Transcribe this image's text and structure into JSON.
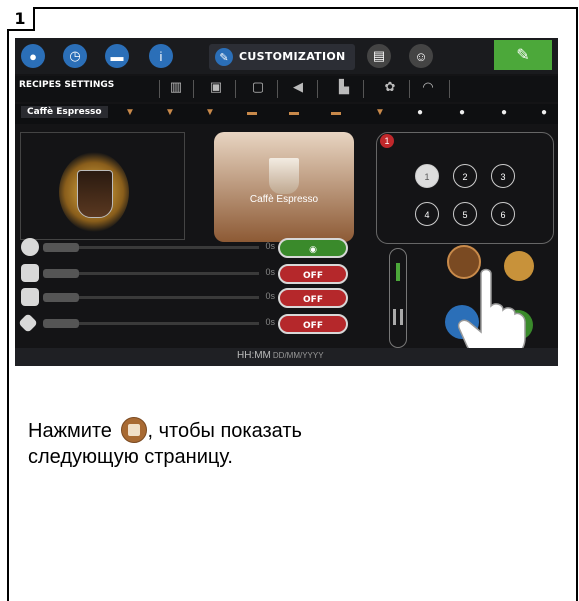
{
  "step": {
    "number": "1"
  },
  "screen": {
    "topbar": {
      "icons": [
        "drop-icon",
        "clock-icon",
        "cup-icon",
        "info-icon",
        "pencil-icon",
        "display-icon",
        "user-icon",
        "wrench-icon"
      ],
      "active_tab_label": "CUSTOMIZATION"
    },
    "submenu": {
      "recipes_settings_label": "RECIPES SETTINGS",
      "icons": [
        "book-icon",
        "picture-icon",
        "screen-icon",
        "speaker-icon",
        "milk-icon",
        "palette-icon",
        "wifi-icon"
      ]
    },
    "beverage_bar": {
      "selected_label": "Caffè Espresso"
    },
    "preview": {
      "name": "Caffè Espresso"
    },
    "number_panel": {
      "badge": "1",
      "buttons": [
        "1",
        "2",
        "3",
        "4",
        "5",
        "6"
      ],
      "selected": "1"
    },
    "settings_rows": [
      {
        "icon": "coffee-bean-icon",
        "time": "0s",
        "toggle": "",
        "toggle_state": "on"
      },
      {
        "icon": "milk-temp-icon",
        "time": "0s",
        "toggle": "OFF",
        "toggle_state": "off"
      },
      {
        "icon": "water-temp-icon",
        "time": "0s",
        "toggle": "OFF",
        "toggle_state": "off"
      },
      {
        "icon": "tablet-icon",
        "time": "0s",
        "toggle": "OFF",
        "toggle_state": "off"
      }
    ],
    "status_bar": {
      "time": "HH:MM",
      "date": "DD/MM/YYYY"
    }
  },
  "caption": {
    "before_icon": "Нажмите ",
    "after_icon": ", чтобы показать",
    "line2": "следующую страницу."
  },
  "colors": {
    "accent_blue": "#2b6fb8",
    "accent_green": "#4ca83a",
    "off_red": "#b5282b",
    "brown": "#a86a33"
  }
}
